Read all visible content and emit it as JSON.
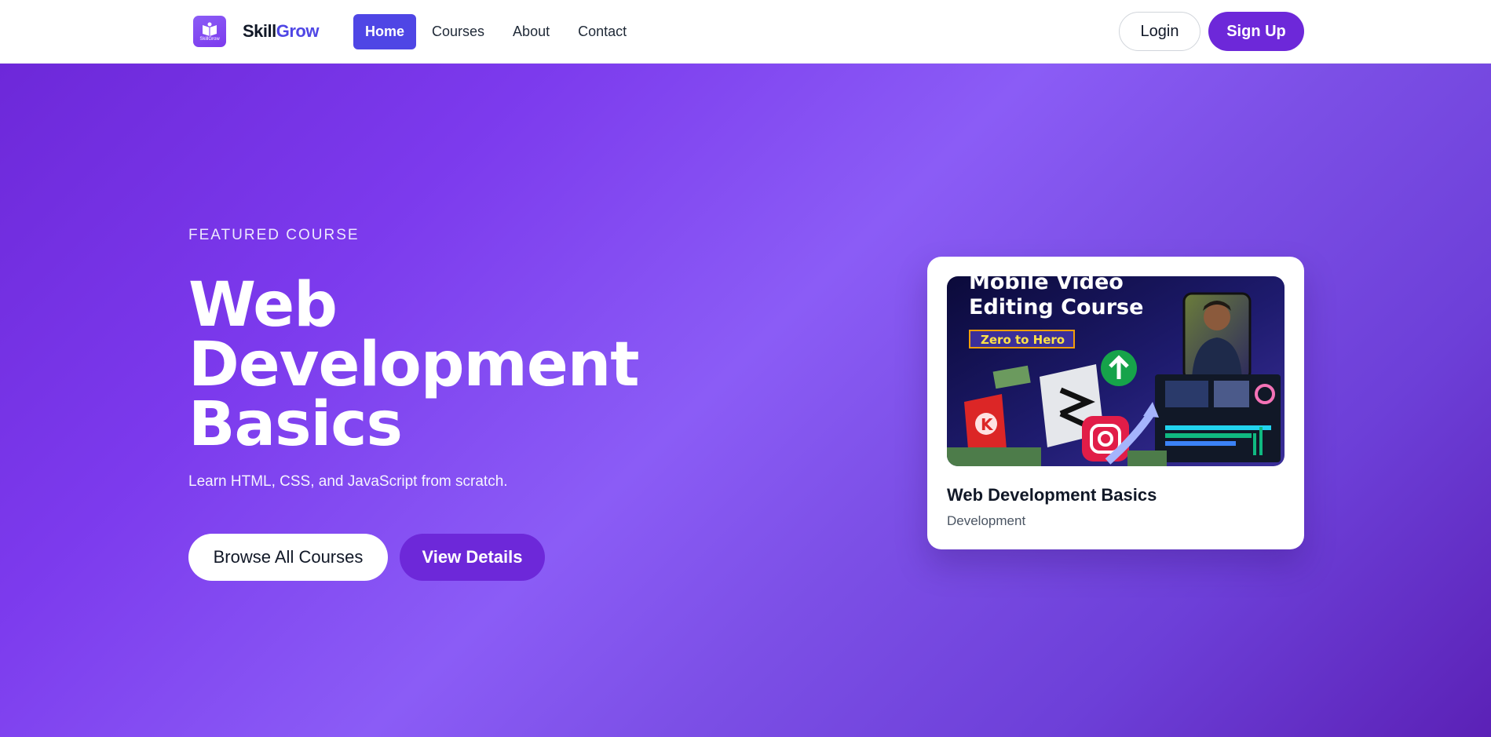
{
  "nav": {
    "brand": {
      "logo_text": "SkillGrow",
      "name_part1": "Skill",
      "name_part2": "Grow"
    },
    "links": [
      {
        "label": "Home",
        "active": true
      },
      {
        "label": "Courses",
        "active": false
      },
      {
        "label": "About",
        "active": false
      },
      {
        "label": "Contact",
        "active": false
      }
    ],
    "login_label": "Login",
    "signup_label": "Sign Up"
  },
  "hero": {
    "eyebrow": "FEATURED COURSE",
    "title_line1": "Web",
    "title_line2": "Development",
    "title_line3": "Basics",
    "subtitle": "Learn HTML, CSS, and JavaScript from scratch.",
    "browse_label": "Browse All Courses",
    "details_label": "View Details"
  },
  "card": {
    "thumbnail": {
      "headline_line1": "Mobile Video",
      "headline_line2": "Editing Course",
      "badge": "Zero to Hero"
    },
    "title": "Web Development Basics",
    "category": "Development"
  },
  "colors": {
    "accent": "#4f46e5",
    "brand_purple": "#6d28d9",
    "hero_light": "#8b5cf6"
  }
}
